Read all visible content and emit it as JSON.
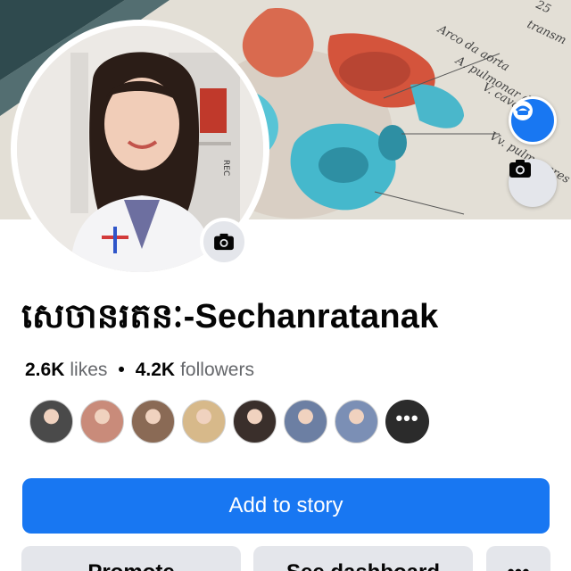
{
  "cover": {
    "diagram_labels": [
      "Arco da aorta",
      "A. pulmonar dir.",
      "V. cava",
      "Vv. pulmonares",
      "transm",
      "25"
    ]
  },
  "profile": {
    "name": "សេចានរតនៈ-Sechanratanak",
    "stats": {
      "likes_count": "2.6K",
      "likes_label": "likes",
      "separator": "•",
      "followers_count": "4.2K",
      "followers_label": "followers"
    }
  },
  "friends": [
    {
      "name": "friend-1",
      "color": "#4a4a4a"
    },
    {
      "name": "friend-2",
      "color": "#c98b7a"
    },
    {
      "name": "friend-3",
      "color": "#8a6a55"
    },
    {
      "name": "friend-4",
      "color": "#d7b98a"
    },
    {
      "name": "friend-5",
      "color": "#3a2f2b"
    },
    {
      "name": "friend-6",
      "color": "#6c7fa3"
    },
    {
      "name": "friend-7",
      "color": "#7b8fb5"
    }
  ],
  "more_friends_label": "•••",
  "actions": {
    "add_story_label": "Add to story",
    "add_story_icon": "+",
    "promote_label": "Promote",
    "dashboard_label": "See dashboard",
    "more_label": "•••"
  },
  "colors": {
    "primary_blue": "#1877f2",
    "secondary_gray": "#e4e6eb",
    "text_secondary": "#65676b"
  },
  "rec_label": "REC"
}
